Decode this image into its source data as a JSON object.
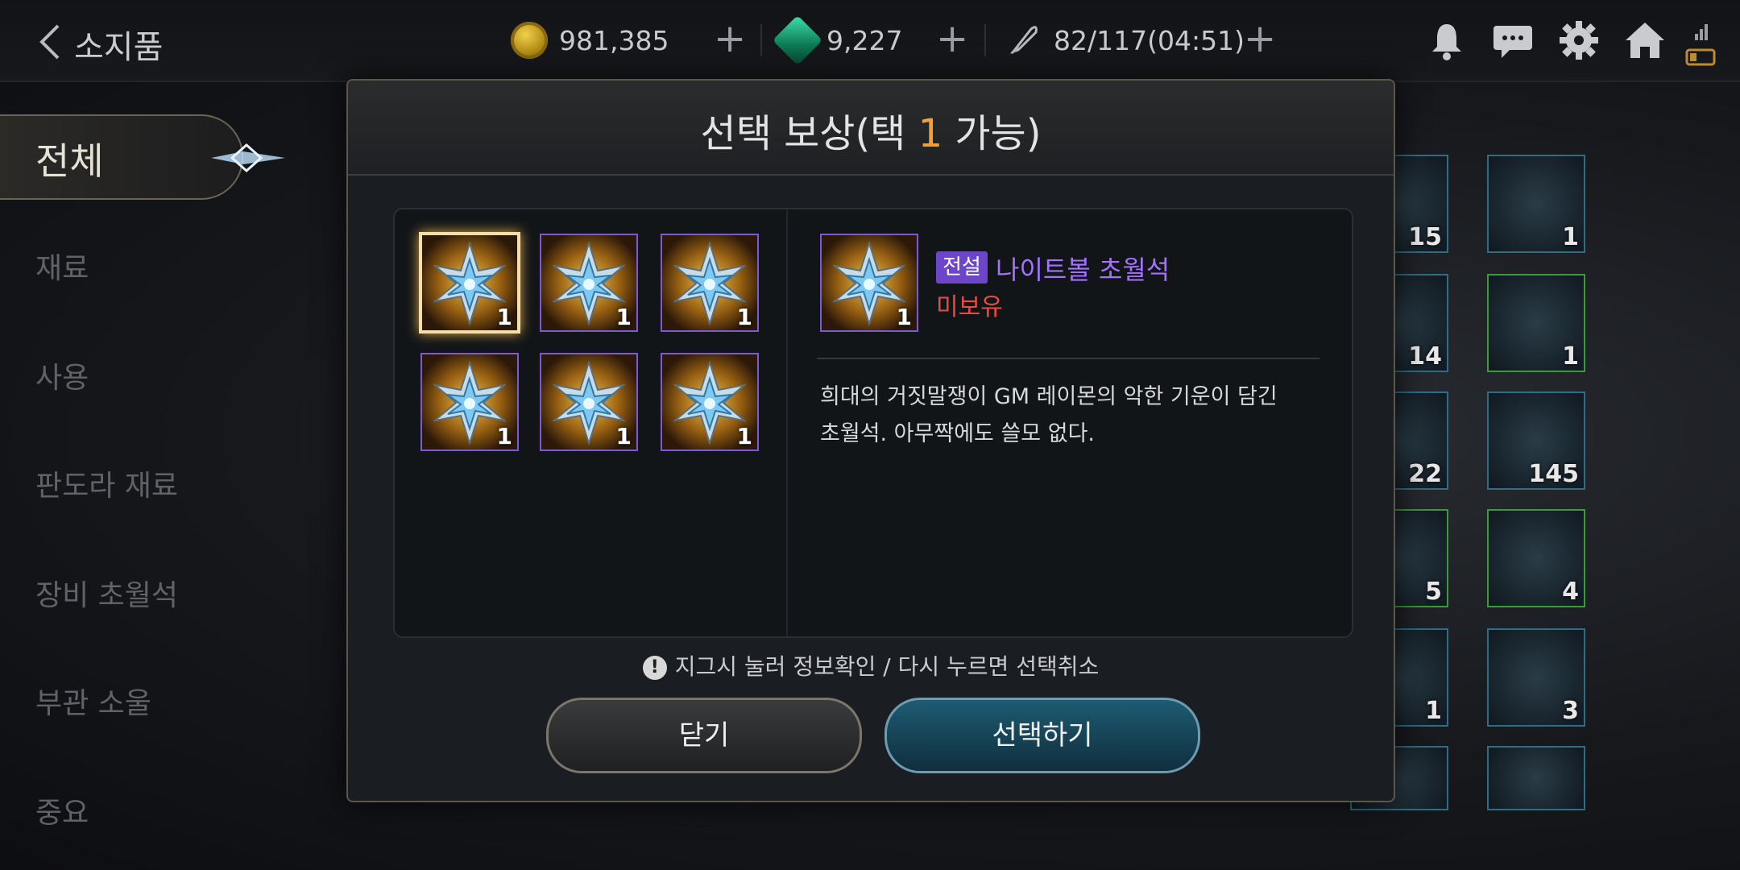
{
  "header": {
    "title": "소지품",
    "gold": "981,385",
    "gems": "9,227",
    "stamina": "82/117(04:51)"
  },
  "menu": {
    "active": "전체",
    "items": [
      "재료",
      "사용",
      "판도라 재료",
      "장비 초월석",
      "부관 소울",
      "중요"
    ]
  },
  "inventory": {
    "counts": [
      "15",
      "1",
      "14",
      "1",
      "22",
      "145",
      "5",
      "4",
      "1",
      "3"
    ]
  },
  "modal": {
    "title_prefix": "선택 보상(택 ",
    "title_count": "1",
    "title_suffix": " 가능)",
    "reward_count": "1",
    "detail": {
      "grade": "전설",
      "name": "나이트볼 초월석",
      "owned_status": "미보유",
      "description_line1": "희대의 거짓말쟁이 GM 레이몬의 악한 기운이 담긴",
      "description_line2": "초월석. 아무짝에도 쓸모 없다."
    },
    "hint": "지그시 눌러 정보확인 / 다시 누르면 선택취소",
    "close_label": "닫기",
    "select_label": "선택하기"
  },
  "colors": {
    "legendary_purple": "#a472ff",
    "not_owned_red": "#ea4a44",
    "highlight_orange": "#f0a132"
  }
}
